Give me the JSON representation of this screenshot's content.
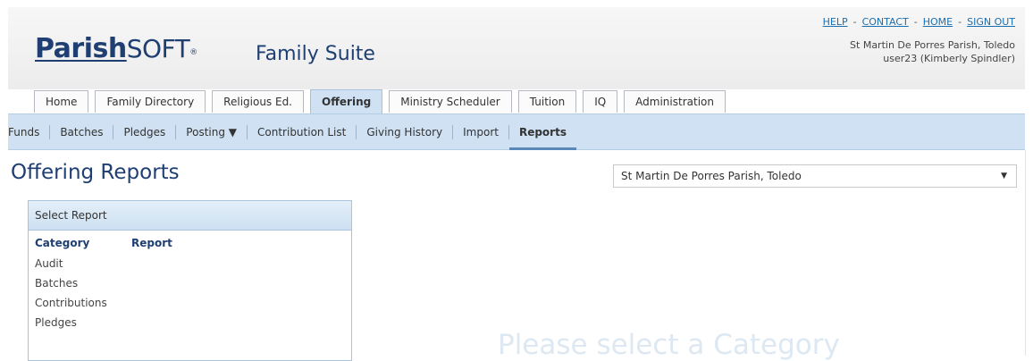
{
  "header": {
    "logo_text_1": "Parish",
    "logo_text_2": "SOFT",
    "logo_reg": "®",
    "suite_title": "Family Suite",
    "links": {
      "help": "HELP",
      "contact": "CONTACT",
      "home": "HOME",
      "sign_out": "SIGN OUT",
      "separator": "-"
    },
    "org_name": "St Martin De Porres Parish, Toledo",
    "user": "user23 (Kimberly Spindler)"
  },
  "tabs": [
    {
      "label": "Home"
    },
    {
      "label": "Family Directory"
    },
    {
      "label": "Religious Ed."
    },
    {
      "label": "Offering",
      "active": true
    },
    {
      "label": "Ministry Scheduler"
    },
    {
      "label": "Tuition"
    },
    {
      "label": "IQ"
    },
    {
      "label": "Administration"
    }
  ],
  "subnav": [
    {
      "label": "Funds"
    },
    {
      "label": "Batches"
    },
    {
      "label": "Pledges"
    },
    {
      "label": "Posting ▼"
    },
    {
      "label": "Contribution List"
    },
    {
      "label": "Giving History"
    },
    {
      "label": "Import"
    },
    {
      "label": "Reports",
      "active": true
    }
  ],
  "main": {
    "page_title": "Offering Reports",
    "parish_select": {
      "value": "St Martin De Porres Parish, Toledo",
      "arrow": "▼"
    },
    "panel": {
      "title": "Select Report",
      "category_header": "Category",
      "report_header": "Report",
      "categories": [
        "Audit",
        "Batches",
        "Contributions",
        "Pledges"
      ]
    },
    "placeholder": "Please select a Category"
  }
}
